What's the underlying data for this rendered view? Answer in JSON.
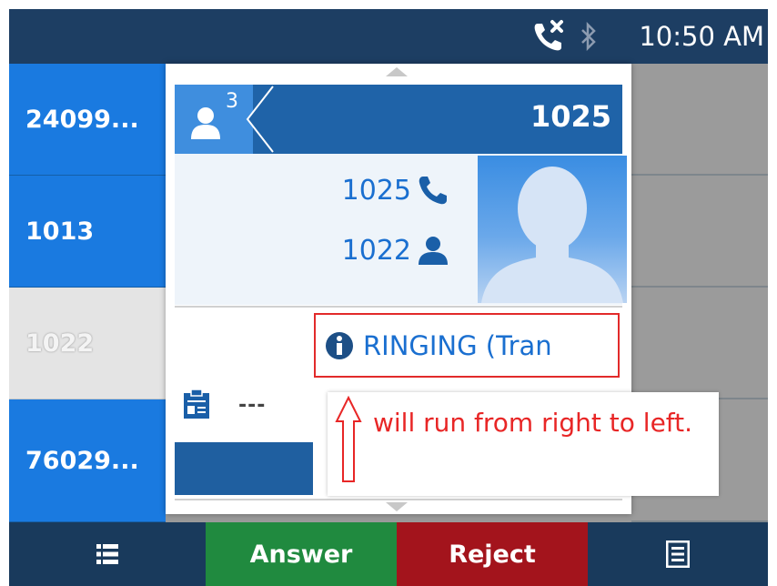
{
  "status_bar": {
    "time": "10:50 AM",
    "icons": [
      "call-blocked-icon",
      "bluetooth-icon"
    ]
  },
  "line_keys": [
    {
      "label": "24099...",
      "state": "active"
    },
    {
      "label": "1013",
      "state": "active"
    },
    {
      "label": "1022",
      "state": "idle"
    },
    {
      "label": "76029...",
      "state": "active"
    }
  ],
  "popup": {
    "header": {
      "conference_count": "3",
      "peer": "1025"
    },
    "participants": [
      {
        "number": "1025",
        "icon": "phone-icon"
      },
      {
        "number": "1022",
        "icon": "person-icon"
      }
    ],
    "status_text": "RINGING (Tran",
    "notes_placeholder": "---"
  },
  "annotation": {
    "text": "will run from right to left."
  },
  "softkeys": {
    "answer": "Answer",
    "reject": "Reject"
  },
  "colors": {
    "accent_blue": "#1a7ae0",
    "header_blue": "#1f63a8",
    "answer_green": "#208a3f",
    "reject_red": "#a3141c",
    "annotation_red": "#e22a2a"
  }
}
